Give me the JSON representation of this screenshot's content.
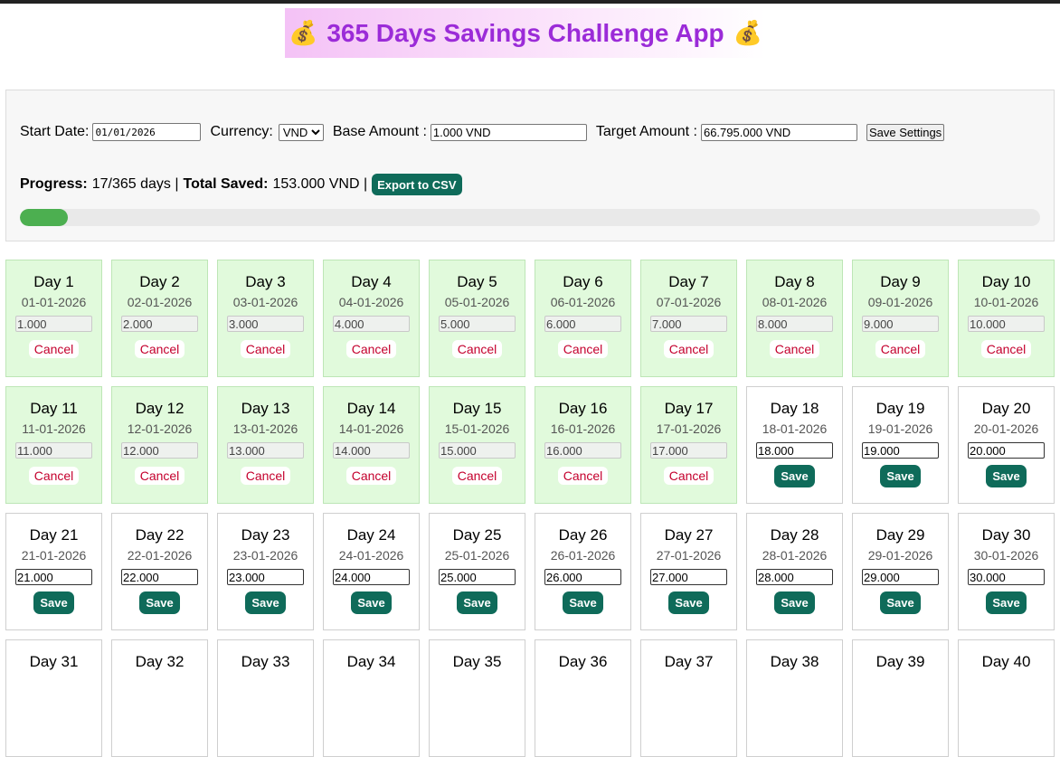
{
  "app": {
    "title": "365 Days Savings Challenge App",
    "title_icon": "💰"
  },
  "settings": {
    "start_date_label": "Start Date:",
    "start_date_value": "01/01/2026",
    "currency_label": "Currency:",
    "currency_value": "VND",
    "base_amount_label": "Base Amount :",
    "base_amount_value": "1.000 VND",
    "target_amount_label": "Target Amount :",
    "target_amount_value": "66.795.000 VND",
    "save_button": "Save Settings"
  },
  "progress": {
    "progress_label": "Progress:",
    "progress_text": "17/365 days |",
    "total_label": "Total Saved:",
    "total_text": "153.000 VND |",
    "export_button": "Export to CSV",
    "completed_days": 17,
    "total_days": 365
  },
  "colors": {
    "accent": "#0f6b5a",
    "progress": "#4caf50",
    "done_card": "#e1fadc",
    "cancel": "#c4002d",
    "title": "#9b2bd8"
  },
  "days": [
    {
      "label": "Day 1",
      "date": "01-01-2026",
      "amount": "1.000",
      "done": true,
      "action": "Cancel"
    },
    {
      "label": "Day 2",
      "date": "02-01-2026",
      "amount": "2.000",
      "done": true,
      "action": "Cancel"
    },
    {
      "label": "Day 3",
      "date": "03-01-2026",
      "amount": "3.000",
      "done": true,
      "action": "Cancel"
    },
    {
      "label": "Day 4",
      "date": "04-01-2026",
      "amount": "4.000",
      "done": true,
      "action": "Cancel"
    },
    {
      "label": "Day 5",
      "date": "05-01-2026",
      "amount": "5.000",
      "done": true,
      "action": "Cancel"
    },
    {
      "label": "Day 6",
      "date": "06-01-2026",
      "amount": "6.000",
      "done": true,
      "action": "Cancel"
    },
    {
      "label": "Day 7",
      "date": "07-01-2026",
      "amount": "7.000",
      "done": true,
      "action": "Cancel"
    },
    {
      "label": "Day 8",
      "date": "08-01-2026",
      "amount": "8.000",
      "done": true,
      "action": "Cancel"
    },
    {
      "label": "Day 9",
      "date": "09-01-2026",
      "amount": "9.000",
      "done": true,
      "action": "Cancel"
    },
    {
      "label": "Day 10",
      "date": "10-01-2026",
      "amount": "10.000",
      "done": true,
      "action": "Cancel"
    },
    {
      "label": "Day 11",
      "date": "11-01-2026",
      "amount": "11.000",
      "done": true,
      "action": "Cancel"
    },
    {
      "label": "Day 12",
      "date": "12-01-2026",
      "amount": "12.000",
      "done": true,
      "action": "Cancel"
    },
    {
      "label": "Day 13",
      "date": "13-01-2026",
      "amount": "13.000",
      "done": true,
      "action": "Cancel"
    },
    {
      "label": "Day 14",
      "date": "14-01-2026",
      "amount": "14.000",
      "done": true,
      "action": "Cancel"
    },
    {
      "label": "Day 15",
      "date": "15-01-2026",
      "amount": "15.000",
      "done": true,
      "action": "Cancel"
    },
    {
      "label": "Day 16",
      "date": "16-01-2026",
      "amount": "16.000",
      "done": true,
      "action": "Cancel"
    },
    {
      "label": "Day 17",
      "date": "17-01-2026",
      "amount": "17.000",
      "done": true,
      "action": "Cancel"
    },
    {
      "label": "Day 18",
      "date": "18-01-2026",
      "amount": "18.000",
      "done": false,
      "action": "Save"
    },
    {
      "label": "Day 19",
      "date": "19-01-2026",
      "amount": "19.000",
      "done": false,
      "action": "Save"
    },
    {
      "label": "Day 20",
      "date": "20-01-2026",
      "amount": "20.000",
      "done": false,
      "action": "Save"
    },
    {
      "label": "Day 21",
      "date": "21-01-2026",
      "amount": "21.000",
      "done": false,
      "action": "Save"
    },
    {
      "label": "Day 22",
      "date": "22-01-2026",
      "amount": "22.000",
      "done": false,
      "action": "Save"
    },
    {
      "label": "Day 23",
      "date": "23-01-2026",
      "amount": "23.000",
      "done": false,
      "action": "Save"
    },
    {
      "label": "Day 24",
      "date": "24-01-2026",
      "amount": "24.000",
      "done": false,
      "action": "Save"
    },
    {
      "label": "Day 25",
      "date": "25-01-2026",
      "amount": "25.000",
      "done": false,
      "action": "Save"
    },
    {
      "label": "Day 26",
      "date": "26-01-2026",
      "amount": "26.000",
      "done": false,
      "action": "Save"
    },
    {
      "label": "Day 27",
      "date": "27-01-2026",
      "amount": "27.000",
      "done": false,
      "action": "Save"
    },
    {
      "label": "Day 28",
      "date": "28-01-2026",
      "amount": "28.000",
      "done": false,
      "action": "Save"
    },
    {
      "label": "Day 29",
      "date": "29-01-2026",
      "amount": "29.000",
      "done": false,
      "action": "Save"
    },
    {
      "label": "Day 30",
      "date": "30-01-2026",
      "amount": "30.000",
      "done": false,
      "action": "Save"
    },
    {
      "label": "Day 31",
      "date": "",
      "amount": "",
      "done": false,
      "action": ""
    },
    {
      "label": "Day 32",
      "date": "",
      "amount": "",
      "done": false,
      "action": ""
    },
    {
      "label": "Day 33",
      "date": "",
      "amount": "",
      "done": false,
      "action": ""
    },
    {
      "label": "Day 34",
      "date": "",
      "amount": "",
      "done": false,
      "action": ""
    },
    {
      "label": "Day 35",
      "date": "",
      "amount": "",
      "done": false,
      "action": ""
    },
    {
      "label": "Day 36",
      "date": "",
      "amount": "",
      "done": false,
      "action": ""
    },
    {
      "label": "Day 37",
      "date": "",
      "amount": "",
      "done": false,
      "action": ""
    },
    {
      "label": "Day 38",
      "date": "",
      "amount": "",
      "done": false,
      "action": ""
    },
    {
      "label": "Day 39",
      "date": "",
      "amount": "",
      "done": false,
      "action": ""
    },
    {
      "label": "Day 40",
      "date": "",
      "amount": "",
      "done": false,
      "action": ""
    }
  ]
}
